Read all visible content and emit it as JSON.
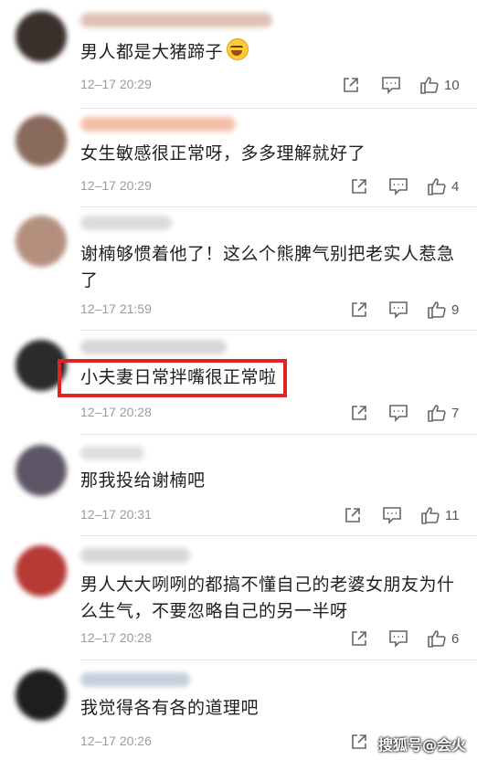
{
  "comments": [
    {
      "text": "男人都是大猪蹄子",
      "time": "12–17 20:29",
      "likes": "10",
      "emoji": "laughing-crying-emoji",
      "avatar_color": "#3a2f2a",
      "name_color": "#d9b7a8"
    },
    {
      "text": "女生敏感很正常呀，多多理解就好了",
      "time": "12–17 20:29",
      "likes": "4",
      "avatar_color": "#8a6a5c",
      "name_color": "#f3b49a"
    },
    {
      "text": "谢楠够惯着他了！这么个熊脾气别把老实人惹急了",
      "time": "12–17 21:59",
      "likes": "9",
      "avatar_color": "#b58f7e",
      "name_color": "#d5d5d5"
    },
    {
      "text": "小夫妻日常拌嘴很正常啦",
      "time": "12–17 20:28",
      "likes": "7",
      "avatar_color": "#2b2b2b",
      "name_color": "#cfcfcf"
    },
    {
      "text": "那我投给谢楠吧",
      "time": "12–17 20:31",
      "likes": "11",
      "avatar_color": "#5d5566",
      "name_color": "#d8d8d8"
    },
    {
      "text": "男人大大咧咧的都搞不懂自己的老婆女朋友为什么生气，不要忽略自己的另一半呀",
      "time": "12–17 20:28",
      "likes": "6",
      "avatar_color": "#b63a36",
      "name_color": "#cfcfcf"
    },
    {
      "text": "我觉得各有各的道理吧",
      "time": "12–17 20:26",
      "likes": "",
      "avatar_color": "#1e1e1e",
      "name_color": "#bcc6d6"
    }
  ],
  "watermark": "搜狐号@会火",
  "highlight_color": "#e02323"
}
